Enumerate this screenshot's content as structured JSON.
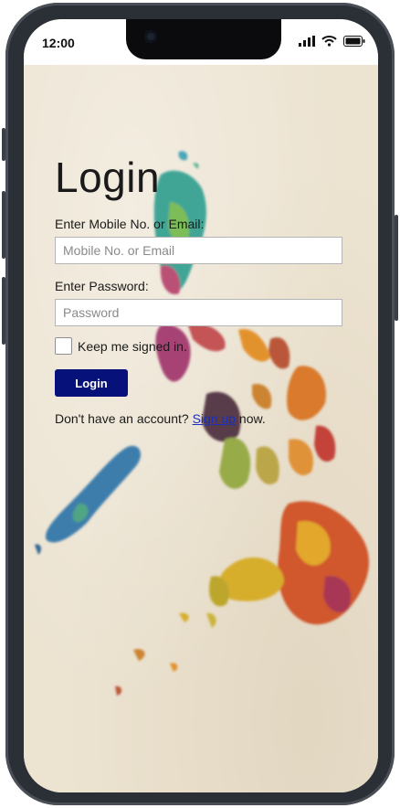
{
  "status_bar": {
    "time": "12:00",
    "signal_icon": "cell-signal-icon",
    "wifi_icon": "wifi-icon",
    "battery_icon": "battery-icon"
  },
  "login": {
    "title": "Login",
    "email_label": "Enter Mobile No. or Email:",
    "email_placeholder": "Mobile No. or Email",
    "password_label": "Enter Password:",
    "password_placeholder": "Password",
    "keep_signed_in": "Keep me signed in.",
    "login_button": "Login",
    "signup_prefix": "Don't have an account? ",
    "signup_link": "Sign up",
    "signup_suffix": " now."
  },
  "colors": {
    "button": "#06117a",
    "paper": "#ece3d1",
    "link": "#1a2fbf"
  }
}
